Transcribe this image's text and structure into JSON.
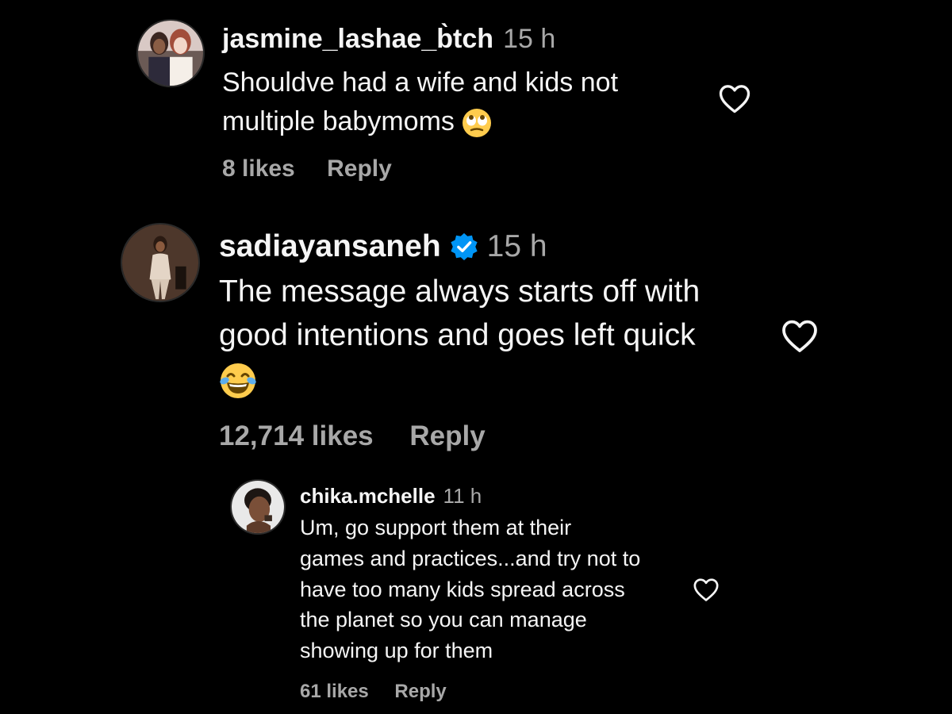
{
  "comments": [
    {
      "username": "jasmine_lashae_b̀tch",
      "timestamp": "15 h",
      "text": "Shouldve had a wife and kids not\nmultiple babymoms",
      "emoji": "face-with-rolling-eyes-icon",
      "likes": "8 likes",
      "reply_label": "Reply",
      "verified": false
    },
    {
      "username": "sadiayansaneh",
      "timestamp": "15 h",
      "text": "The message always starts off with\ngood intentions and goes left quick\n",
      "emoji": "face-with-tears-of-joy-icon",
      "likes": "12,714 likes",
      "reply_label": "Reply",
      "verified": true
    },
    {
      "username": "chika.mchelle",
      "timestamp": "11 h",
      "text": "Um, go support them at their\ngames and practices...and try not to\nhave too many kids spread across\nthe planet so you can manage\nshowing up for them",
      "likes": "61 likes",
      "reply_label": "Reply",
      "verified": false
    }
  ],
  "colors": {
    "background": "#000000",
    "primary_text": "#f5f5f5",
    "secondary_text": "#a8a8a8",
    "verified_badge": "#0095f6"
  }
}
